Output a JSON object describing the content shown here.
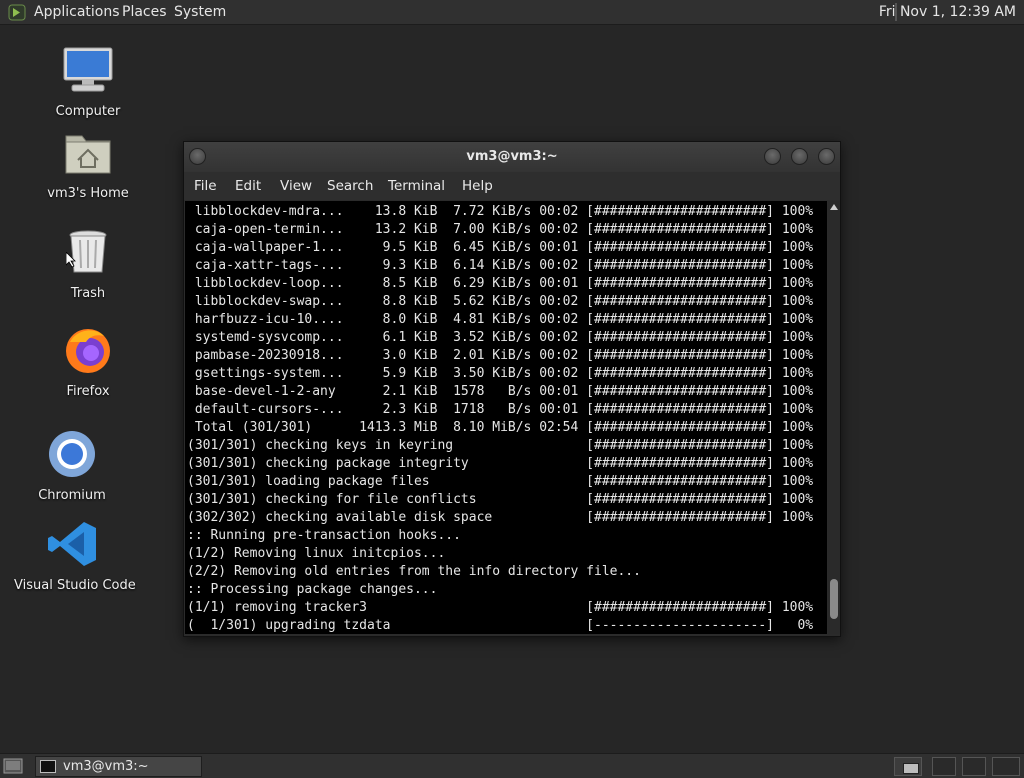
{
  "top_panel": {
    "menus": [
      "Applications",
      "Places",
      "System"
    ],
    "clock": "Fri Nov  1, 12:39 AM"
  },
  "desktop_icons": [
    {
      "label": "Computer",
      "icon": "computer-icon"
    },
    {
      "label": "vm3's Home",
      "icon": "home-folder-icon"
    },
    {
      "label": "Trash",
      "icon": "trash-icon"
    },
    {
      "label": "Firefox",
      "icon": "firefox-icon"
    },
    {
      "label": "Chromium",
      "icon": "chromium-icon"
    },
    {
      "label": "Visual Studio Code",
      "icon": "vscode-icon"
    }
  ],
  "terminal": {
    "title": "vm3@vm3:~",
    "menus": [
      "File",
      "Edit",
      "View",
      "Search",
      "Terminal",
      "Help"
    ],
    "lines": [
      " libblockdev-mdra...    13.8 KiB  7.72 KiB/s 00:02 [######################] 100%",
      " caja-open-termin...    13.2 KiB  7.00 KiB/s 00:02 [######################] 100%",
      " caja-wallpaper-1...     9.5 KiB  6.45 KiB/s 00:01 [######################] 100%",
      " caja-xattr-tags-...     9.3 KiB  6.14 KiB/s 00:02 [######################] 100%",
      " libblockdev-loop...     8.5 KiB  6.29 KiB/s 00:01 [######################] 100%",
      " libblockdev-swap...     8.8 KiB  5.62 KiB/s 00:02 [######################] 100%",
      " harfbuzz-icu-10....     8.0 KiB  4.81 KiB/s 00:02 [######################] 100%",
      " systemd-sysvcomp...     6.1 KiB  3.52 KiB/s 00:02 [######################] 100%",
      " pambase-20230918...     3.0 KiB  2.01 KiB/s 00:02 [######################] 100%",
      " gsettings-system...     5.9 KiB  3.50 KiB/s 00:02 [######################] 100%",
      " base-devel-1-2-any      2.1 KiB  1578   B/s 00:01 [######################] 100%",
      " default-cursors-...     2.3 KiB  1718   B/s 00:01 [######################] 100%",
      " Total (301/301)      1413.3 MiB  8.10 MiB/s 02:54 [######################] 100%",
      "(301/301) checking keys in keyring                 [######################] 100%",
      "(301/301) checking package integrity               [######################] 100%",
      "(301/301) loading package files                    [######################] 100%",
      "(301/301) checking for file conflicts              [######################] 100%",
      "(302/302) checking available disk space            [######################] 100%",
      ":: Running pre-transaction hooks...",
      "(1/2) Removing linux initcpios...",
      "(2/2) Removing old entries from the info directory file...",
      ":: Processing package changes...",
      "(1/1) removing tracker3                            [######################] 100%",
      "(  1/301) upgrading tzdata                         [----------------------]   0%"
    ]
  },
  "taskbar": {
    "task_label": "vm3@vm3:~"
  }
}
